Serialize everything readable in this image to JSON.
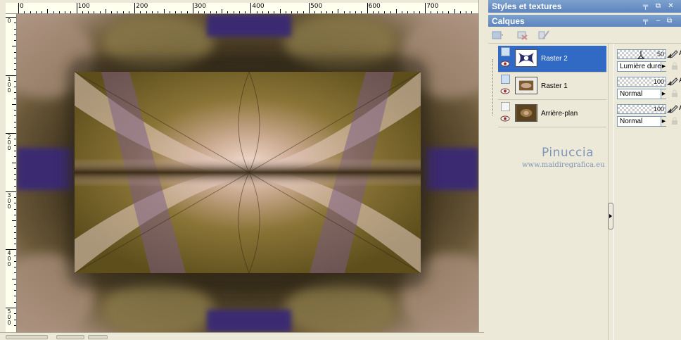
{
  "ruler": {
    "h_labels": [
      "0",
      "100",
      "200",
      "300",
      "400",
      "500",
      "600",
      "700"
    ],
    "v_labels": [
      "0",
      "100",
      "200",
      "300",
      "400",
      "500"
    ]
  },
  "panels": {
    "styles_title": "Styles et textures",
    "layers_title": "Calques",
    "pin_glyph": "╤",
    "minimize_glyph": "–",
    "restore_glyph": "⧉",
    "close_glyph": "✕"
  },
  "layers": [
    {
      "name": "Raster 2",
      "selected": true,
      "opacity": "50",
      "blend": "Lumière dure"
    },
    {
      "name": "Raster 1",
      "selected": false,
      "opacity": "100",
      "blend": "Normal"
    },
    {
      "name": "Arrière-plan",
      "selected": false,
      "opacity": "100",
      "blend": "Normal"
    }
  ],
  "watermark": {
    "name": "Pinuccia",
    "url": "www.maidiregrafica.eu"
  },
  "props_cut_letter": "A",
  "colors": {
    "title_bar": "#6b8fc4",
    "selection": "#316ac5",
    "watermark": "#7f97b8",
    "canvas_purple": "#3a2a6e",
    "canvas_olive": "#6b5a1e",
    "canvas_pink": "#d8b0b8"
  },
  "icons": {
    "vis": "layer-visibility-icon",
    "eye": "eye-icon",
    "pen": "edit-icon",
    "lock": "lock-icon"
  }
}
